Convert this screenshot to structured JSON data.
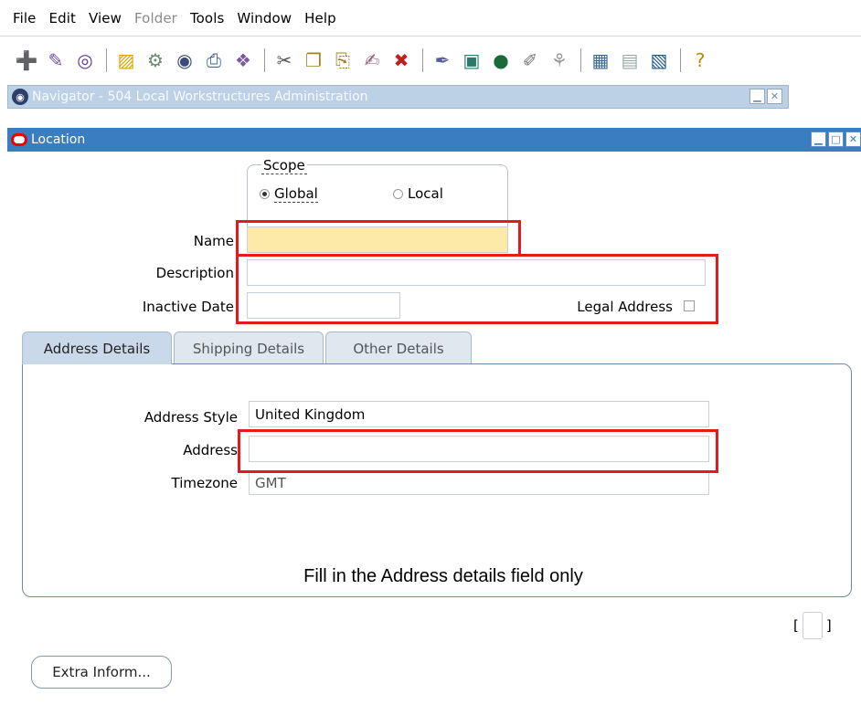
{
  "menu": {
    "items": [
      {
        "label": "File",
        "disabled": false
      },
      {
        "label": "Edit",
        "disabled": false
      },
      {
        "label": "View",
        "disabled": false
      },
      {
        "label": "Folder",
        "disabled": true
      },
      {
        "label": "Tools",
        "disabled": false
      },
      {
        "label": "Window",
        "disabled": false
      },
      {
        "label": "Help",
        "disabled": false
      }
    ]
  },
  "toolbar": {
    "icons": [
      "new-icon",
      "flashlight-icon",
      "navigator-icon",
      "sep",
      "open-folder-icon",
      "zoom-icon",
      "save-icon",
      "print-icon",
      "close-form-icon",
      "sep",
      "cut-icon",
      "copy-icon",
      "paste-icon",
      "new-record-icon",
      "delete-record-icon",
      "sep",
      "edit-field-icon",
      "translations-icon",
      "globe-icon",
      "attachments-icon",
      "folder-tools-icon",
      "sep",
      "calendar-icon",
      "clear-icon",
      "window-icon",
      "sep",
      "help-icon"
    ]
  },
  "navigator": {
    "title": "Navigator - 504 Local Workstructures Administration"
  },
  "location_window": {
    "title": "Location"
  },
  "form": {
    "scope": {
      "label": "Scope",
      "options": [
        {
          "label": "Global",
          "checked": true
        },
        {
          "label": "Local",
          "checked": false
        }
      ]
    },
    "name_label": "Name",
    "name_value": "",
    "description_label": "Description",
    "description_value": "",
    "inactive_date_label": "Inactive Date",
    "inactive_date_value": "",
    "legal_address_label": "Legal Address",
    "legal_address_checked": false
  },
  "tabs": [
    {
      "label": "Address Details",
      "active": true
    },
    {
      "label": "Shipping Details",
      "active": false
    },
    {
      "label": "Other Details",
      "active": false
    }
  ],
  "address_details": {
    "address_style_label": "Address Style",
    "address_style_value": "United Kingdom",
    "address_label": "Address",
    "address_value": "",
    "timezone_label": "Timezone",
    "timezone_value": "GMT"
  },
  "instruction": "Fill in the Address details field only",
  "bottom": {
    "bracket_open": "[",
    "bracket_close": "]",
    "extra_button_label": "Extra Inform..."
  },
  "colors": {
    "title_bar": "#3a7dc1",
    "navigator_bar": "#bcd1e6",
    "required_field": "#fde9a8",
    "highlight_box": "#e41b1b"
  }
}
